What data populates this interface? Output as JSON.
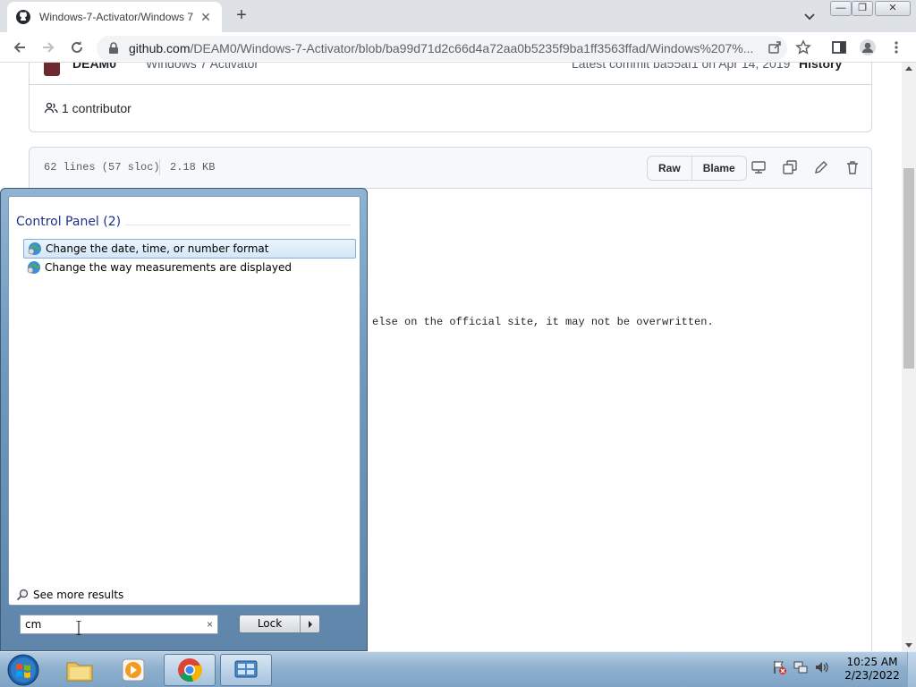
{
  "browser": {
    "tab_title": "Windows-7-Activator/Windows 7",
    "url_domain": "github.com",
    "url_path": "/DEAM0/Windows-7-Activator/blob/ba99d71d2c66d4a72aa0b5235f9ba1ff3563ffad/Windows%207%..."
  },
  "github": {
    "commit_author": "DEAM0",
    "commit_message": "Windows 7 Activator",
    "latest_commit": "Latest commit ba55af1 on Apr 14, 2019",
    "history_label": "History",
    "contributors": "1 contributor",
    "file_lines": "62 lines (57 sloc)",
    "file_size": "2.18 KB",
    "raw_label": "Raw",
    "blame_label": "Blame",
    "code_line": "else on the official site, it may not be overwritten."
  },
  "start_menu": {
    "group_header": "Control Panel (2)",
    "results": [
      {
        "label": "Change the date, time, or number format",
        "selected": true
      },
      {
        "label": "Change the way measurements are displayed",
        "selected": false
      }
    ],
    "see_more": "See more results",
    "search_value": "cm",
    "clear_symbol": "×",
    "lock_label": "Lock"
  },
  "taskbar": {
    "apps": [
      "start-orb",
      "windows-explorer",
      "media-player",
      "google-chrome",
      "control-panel"
    ],
    "time": "10:25 AM",
    "date": "2/23/2022"
  },
  "colors": {
    "github_border": "#d0d7de",
    "start_menu_header": "#1e3287",
    "selection": "#d5e7f8"
  }
}
